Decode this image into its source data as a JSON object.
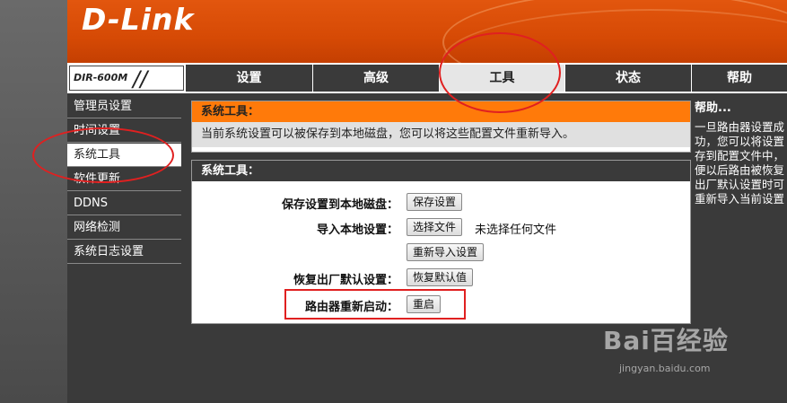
{
  "brand": {
    "logo": "D-Link",
    "model": "DIR-600M"
  },
  "nav": {
    "tabs": [
      {
        "label": "设置"
      },
      {
        "label": "高级"
      },
      {
        "label": "工具"
      },
      {
        "label": "状态"
      },
      {
        "label": "帮助"
      }
    ],
    "active_tab": "工具"
  },
  "sidebar": {
    "items": [
      {
        "label": "管理员设置"
      },
      {
        "label": "时间设置"
      },
      {
        "label": "系统工具"
      },
      {
        "label": "软件更新"
      },
      {
        "label": "DDNS"
      },
      {
        "label": "网络检测"
      },
      {
        "label": "系统日志设置"
      }
    ],
    "active": "系统工具"
  },
  "info_panel": {
    "title": "系统工具：",
    "description": "当前系统设置可以被保存到本地磁盘，您可以将这些配置文件重新导入。"
  },
  "tools_panel": {
    "title": "系统工具：",
    "save_label": "保存设置到本地磁盘：",
    "save_button": "保存设置",
    "import_label": "导入本地设置：",
    "choose_file_button": "选择文件",
    "no_file_text": "未选择任何文件",
    "reimport_button": "重新导入设置",
    "restore_label": "恢复出厂默认设置：",
    "restore_button": "恢复默认值",
    "reboot_label": "路由器重新启动：",
    "reboot_button": "重启"
  },
  "help": {
    "title": "帮助...",
    "lines": [
      "一旦路由器设置成",
      "功，您可以将设置",
      "存到配置文件中，",
      "便以后路由被恢复",
      "出厂默认设置时可",
      "重新导入当前设置"
    ]
  },
  "watermark": {
    "main": "Bai百经验",
    "url": "jingyan.baidu.com"
  },
  "colors": {
    "accent": "#ff7a0a",
    "banner": "#d64a05",
    "dark": "#3a3a3a",
    "annotation": "#e02020"
  }
}
